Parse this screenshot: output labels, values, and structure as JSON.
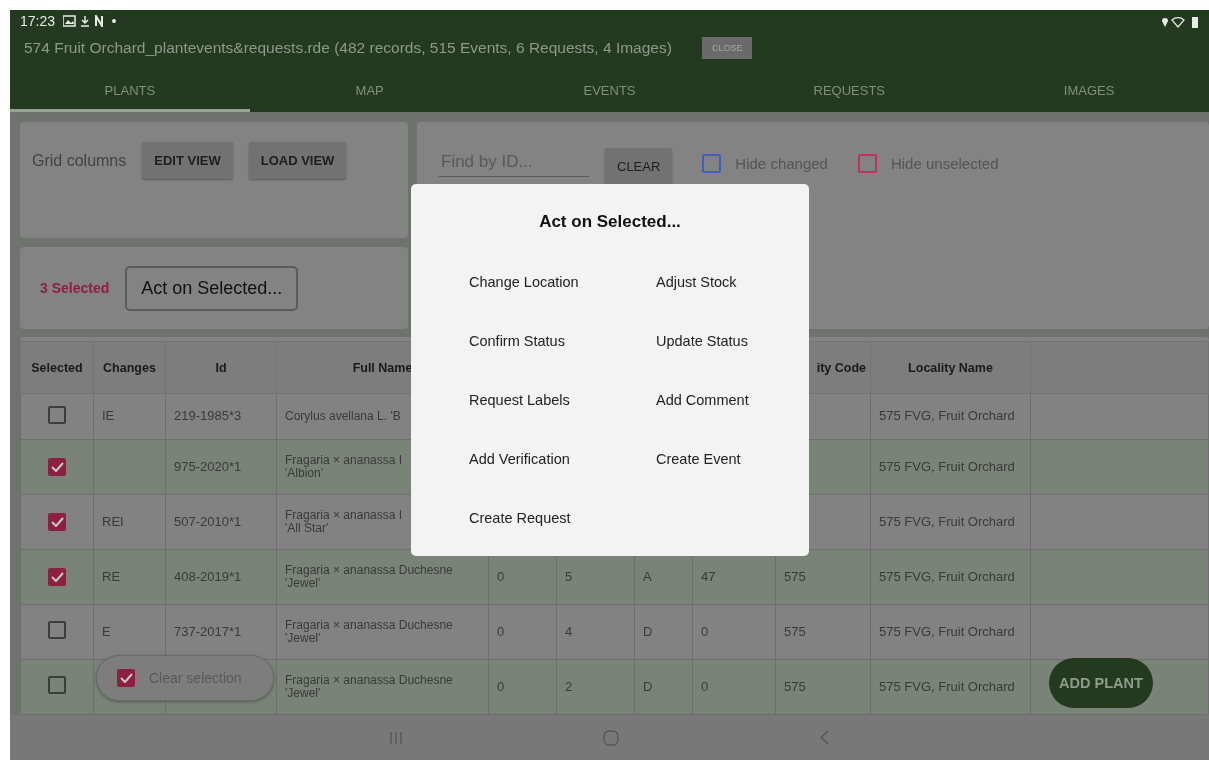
{
  "status_bar": {
    "time": "17:23"
  },
  "window": {
    "title": "574 Fruit Orchard_plantevents&requests.rde (482 records, 515 Events, 6 Requests, 4 Images)",
    "close_button": "CLOSE"
  },
  "tabs": [
    {
      "label": "PLANTS",
      "selected": true
    },
    {
      "label": "MAP",
      "selected": false
    },
    {
      "label": "EVENTS",
      "selected": false
    },
    {
      "label": "REQUESTS",
      "selected": false
    },
    {
      "label": "IMAGES",
      "selected": false
    }
  ],
  "grid_panel": {
    "label": "Grid columns",
    "buttons": [
      "EDIT VIEW",
      "LOAD VIEW"
    ]
  },
  "selection_panel": {
    "count": "3 Selected",
    "button": "Act on Selected..."
  },
  "filter_panel": {
    "search": {
      "placeholder": "Find by ID..."
    },
    "clear_button": "CLEAR",
    "options": [
      {
        "label": "Hide changed",
        "checked": false,
        "color": "#3f5fbf"
      },
      {
        "label": "Hide unselected",
        "checked": false,
        "color": "#c0305a"
      }
    ]
  },
  "table": {
    "selection_header": "Selected",
    "columns": [
      "Changes",
      "Id",
      "Full Name",
      "",
      "",
      "",
      "",
      "ity Code",
      "Locality Name",
      ""
    ],
    "rows": [
      {
        "selected": false,
        "cells": [
          "IE",
          "219-1985*3",
          "Corylus avellana L. 'B",
          "",
          "",
          "",
          "",
          "",
          "575 FVG, Fruit Orchard"
        ]
      },
      {
        "selected": true,
        "cells": [
          "",
          "975-2020*1",
          "Fragaria × ananassa I\n'Albion'",
          "",
          "",
          "",
          "",
          "",
          "575 FVG, Fruit Orchard"
        ]
      },
      {
        "selected": true,
        "cells": [
          "REI",
          "507-2010*1",
          "Fragaria × ananassa I\n'All Star'",
          "",
          "",
          "",
          "",
          "",
          "575 FVG, Fruit Orchard"
        ]
      },
      {
        "selected": true,
        "cells": [
          "RE",
          "408-2019*1",
          "Fragaria × ananassa Duchesne\n'Jewel'",
          "0",
          "5",
          "A",
          "47",
          "575",
          "575 FVG, Fruit Orchard"
        ]
      },
      {
        "selected": false,
        "cells": [
          "E",
          "737-2017*1",
          "Fragaria × ananassa Duchesne\n'Jewel'",
          "0",
          "4",
          "D",
          "0",
          "575",
          "575 FVG, Fruit Orchard"
        ]
      },
      {
        "selected": false,
        "cells": [
          "",
          "",
          "Fragaria × ananassa Duchesne\n'Jewel'",
          "0",
          "2",
          "D",
          "0",
          "575",
          "575 FVG, Fruit Orchard"
        ]
      }
    ]
  },
  "clear_selection": {
    "label": "Clear selection",
    "checked": true
  },
  "add_plant_button": "ADD PLANT",
  "dialog": {
    "title": "Act on Selected...",
    "actions": [
      "Change Location",
      "Adjust Stock",
      "Confirm Status",
      "Update Status",
      "Request Labels",
      "Add Comment",
      "Add Verification",
      "Create Event",
      "Create Request"
    ]
  }
}
